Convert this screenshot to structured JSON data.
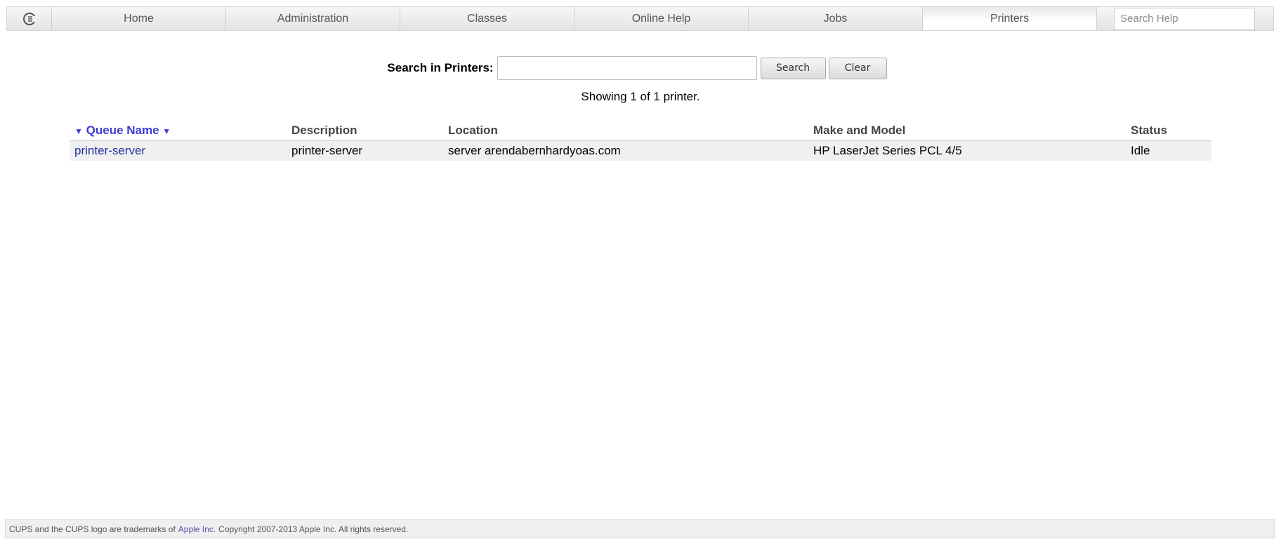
{
  "nav": {
    "tabs": [
      {
        "label": "Home"
      },
      {
        "label": "Administration"
      },
      {
        "label": "Classes"
      },
      {
        "label": "Online Help"
      },
      {
        "label": "Jobs"
      },
      {
        "label": "Printers"
      }
    ],
    "active_tab": "Printers",
    "search_placeholder": "Search Help",
    "logo_icon": "cups-logo-icon"
  },
  "search": {
    "label": "Search in Printers:",
    "value": "",
    "search_button": "Search",
    "clear_button": "Clear"
  },
  "showing": "Showing 1 of 1 printer.",
  "table": {
    "sort_arrow": "▼",
    "columns": [
      "Queue Name",
      "Description",
      "Location",
      "Make and Model",
      "Status"
    ],
    "rows": [
      {
        "queue_name": "printer-server",
        "description": "printer-server",
        "location": "server arendabernhardyoas.com",
        "make_model": "HP LaserJet Series PCL 4/5",
        "status": "Idle"
      }
    ]
  },
  "footer": {
    "prefix": "CUPS and the CUPS logo are trademarks of",
    "link": "Apple Inc.",
    "suffix": "Copyright 2007-2013 Apple Inc. All rights reserved."
  },
  "colors": {
    "link": "#1f2fa0",
    "sort_link": "#3b3bd4",
    "row_bg": "#f0f0f0"
  }
}
